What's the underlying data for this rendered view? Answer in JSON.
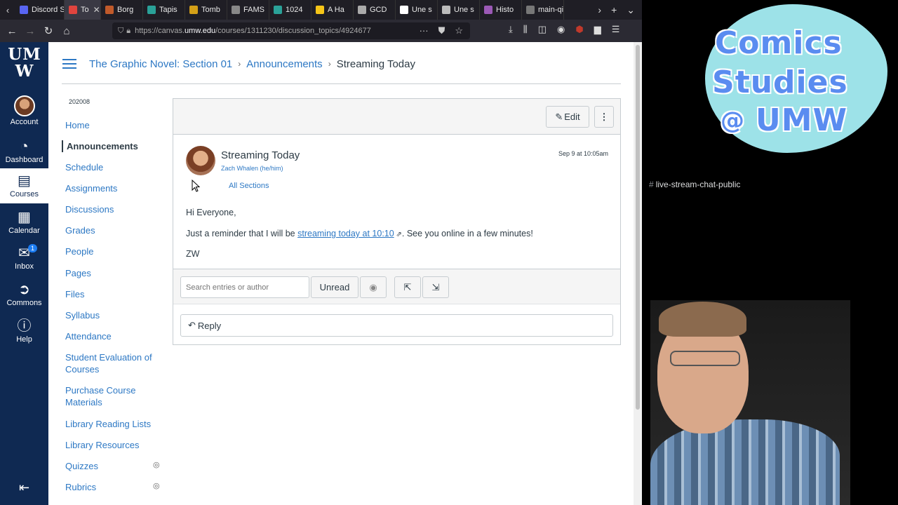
{
  "browser": {
    "tabs": [
      {
        "label": "Discord S",
        "color": "#5865f2"
      },
      {
        "label": "To",
        "color": "#e0443e",
        "active": true
      },
      {
        "label": "Borg",
        "color": "#c05a2a"
      },
      {
        "label": "Tapis",
        "color": "#2aa198"
      },
      {
        "label": "Tomb",
        "color": "#d4a017"
      },
      {
        "label": "FAMS",
        "color": "#888888"
      },
      {
        "label": "1024",
        "color": "#2aa198"
      },
      {
        "label": "A Ha",
        "color": "#f5c518"
      },
      {
        "label": "GCD",
        "color": "#aaaaaa"
      },
      {
        "label": "Une s",
        "color": "#ffffff"
      },
      {
        "label": "Une s",
        "color": "#bbbbbb"
      },
      {
        "label": "Histo",
        "color": "#9b59b6"
      },
      {
        "label": "main-qim",
        "color": "#777777"
      }
    ],
    "url_prefix": "https://canvas.",
    "url_domain": "umw.edu",
    "url_path": "/courses/1311230/discussion_topics/4924677"
  },
  "global_nav": {
    "logo_line1": "UM",
    "logo_line2": "W",
    "items": [
      {
        "label": "Account",
        "icon": "avatar"
      },
      {
        "label": "Dashboard",
        "icon": "dashboard-icon"
      },
      {
        "label": "Courses",
        "icon": "courses-icon"
      },
      {
        "label": "Calendar",
        "icon": "calendar-icon"
      },
      {
        "label": "Inbox",
        "icon": "inbox-icon",
        "badge": "1"
      },
      {
        "label": "Commons",
        "icon": "commons-icon"
      },
      {
        "label": "Help",
        "icon": "help-icon"
      }
    ]
  },
  "breadcrumb": {
    "course": "The Graphic Novel: Section 01",
    "section": "Announcements",
    "page": "Streaming Today"
  },
  "course_nav": {
    "term": "202008",
    "items": [
      "Home",
      "Announcements",
      "Schedule",
      "Assignments",
      "Discussions",
      "Grades",
      "People",
      "Pages",
      "Files",
      "Syllabus",
      "Attendance",
      "Student Evaluation of Courses",
      "Purchase Course Materials",
      "Library Reading Lists",
      "Library Resources",
      "Quizzes",
      "Rubrics"
    ]
  },
  "toolbar": {
    "edit_label": "Edit",
    "more_icon": "more-icon"
  },
  "post": {
    "title": "Streaming Today",
    "author": "Zach Whalen (he/him)",
    "date": "Sep 9 at 10:05am",
    "sections": "All Sections",
    "greeting": "Hi Everyone,",
    "body_before": "Just a reminder that I will be ",
    "link_text": "streaming today at 10:10",
    "body_after": ". See you online in a few minutes!",
    "signoff": "ZW"
  },
  "replies": {
    "search_placeholder": "Search entries or author",
    "unread_label": "Unread",
    "reply_label": "Reply"
  },
  "overlay": {
    "logo_line1": "Comics",
    "logo_line2": "Studies",
    "logo_at": "@",
    "logo_line3": "UMW",
    "chat_channel": "live-stream-chat-public",
    "chat_hash": "#"
  }
}
